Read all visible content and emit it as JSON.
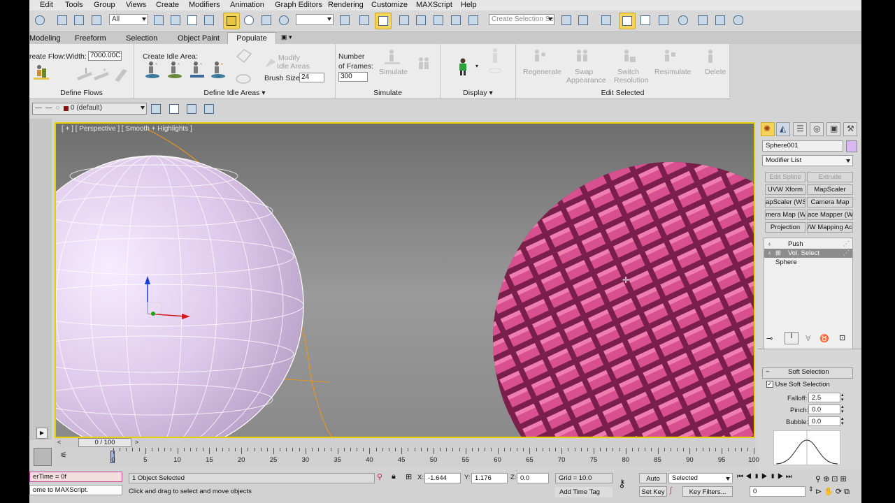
{
  "menu": [
    "Edit",
    "Tools",
    "Group",
    "Views",
    "Create",
    "Modifiers",
    "Animation",
    "Graph Editors",
    "Rendering",
    "Customize",
    "MAXScript",
    "Help"
  ],
  "toolbar": {
    "filter_value": "All",
    "selection_set_placeholder": "Create Selection Se",
    "ref_coord_value": ""
  },
  "ribbon_tabs": [
    "Modeling",
    "Freeform",
    "Selection",
    "Object Paint",
    "Populate"
  ],
  "ribbon": {
    "create_flow_label": "reate Flow:",
    "width_label": "Width:",
    "width_value": "7000.00C",
    "define_flows": "Define Flows",
    "create_idle_area_label": "Create Idle Area:",
    "modify_idle_areas": "Modify\nIdle Areas",
    "modify_idle_l1": "Modify",
    "modify_idle_l2": "Idle Areas",
    "brush_size_label": "Brush Size:",
    "brush_size_value": "24",
    "define_idle_areas": "Define Idle Areas",
    "number_label": "Number",
    "of_frames_label": "of Frames:",
    "frames_value": "300",
    "simulate_btn": "Simulate",
    "simulate_group": "Simulate",
    "display_group": "Display",
    "regenerate": "Regenerate",
    "swap_l1": "Swap",
    "swap_l2": "Appearance",
    "switch_l1": "Switch",
    "switch_l2": "Resolution",
    "resimulate": "Resimulate",
    "delete": "Delete",
    "edit_selected": "Edit Selected"
  },
  "layer": {
    "current": "0 (default)"
  },
  "viewport": {
    "label": "[ + ] [ Perspective ] [ Smooth + Highlights ]"
  },
  "command_panel": {
    "object_name": "Sphere001",
    "modifier_list": "Modifier List",
    "buttons": [
      [
        "Edit Spline",
        "Extrude"
      ],
      [
        "UVW Xform",
        "MapScaler"
      ],
      [
        "apScaler (WSM",
        "Camera Map"
      ],
      [
        "mera Map (WS",
        "ace Mapper (W"
      ],
      [
        "Projection",
        "/W Mapping Ac"
      ]
    ],
    "stack": [
      "Push",
      "Vol. Select",
      "Sphere"
    ],
    "rollout_title": "Soft Selection",
    "use_soft_selection": "Use Soft Selection",
    "falloff_label": "Falloff:",
    "falloff_value": "2.5",
    "pinch_label": "Pinch:",
    "pinch_value": "0.0",
    "bubble_label": "Bubble:",
    "bubble_value": "0.0"
  },
  "timeline": {
    "slider_label": "0 / 100",
    "ticks": [
      "0",
      "5",
      "10",
      "15",
      "20",
      "25",
      "30",
      "35",
      "40",
      "45",
      "50",
      "55",
      "60",
      "65",
      "70",
      "75",
      "80",
      "85",
      "90",
      "95",
      "100"
    ]
  },
  "status": {
    "maxscript_line1": "erTime = 0f",
    "maxscript_line2": "ome to MAXScript.",
    "selected": "1 Object Selected",
    "prompt": "Click and drag to select and move objects",
    "x_label": "X:",
    "x_value": "-1.644",
    "y_label": "Y:",
    "y_value": "1.176",
    "z_label": "Z:",
    "z_value": "0.0",
    "grid": "Grid = 10.0",
    "add_time_tag": "Add Time Tag",
    "auto_key": "Auto Key",
    "set_key": "Set Key",
    "selected_combo": "Selected",
    "key_filters": "Key Filters...",
    "frame_value": "0"
  },
  "colors": {
    "viewport_border": "#e8d000",
    "accent_active": "#f4d35a",
    "selection_pink": "#c8407e"
  }
}
